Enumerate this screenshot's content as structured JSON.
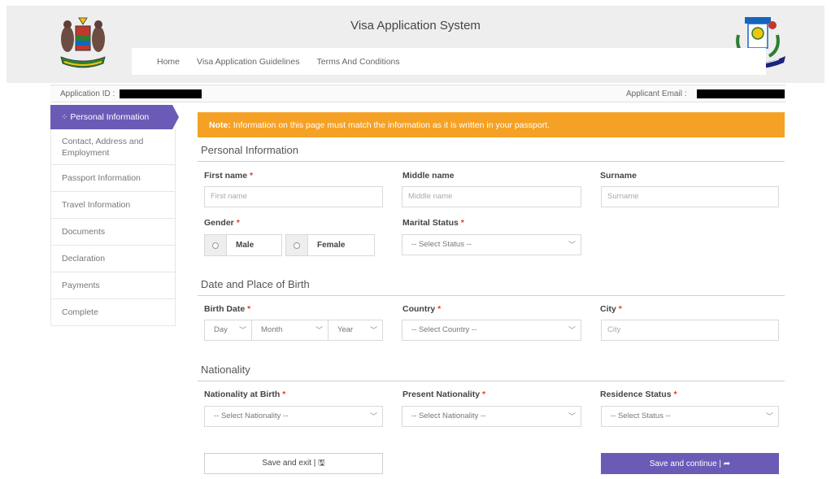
{
  "header": {
    "title": "Visa Application System",
    "nav": [
      "Home",
      "Visa Application Guidelines",
      "Terms And Conditions"
    ],
    "logo_left": "coat-of-arms-icon",
    "logo_right": "immigration-seal-icon"
  },
  "idbar": {
    "application_id_label": "Application ID :",
    "applicant_email_label": "Applicant Email :"
  },
  "sidebar": {
    "items": [
      {
        "label": "Personal Information",
        "active": true
      },
      {
        "label": "Contact, Address and Employment"
      },
      {
        "label": "Passport Information"
      },
      {
        "label": "Travel Information"
      },
      {
        "label": "Documents"
      },
      {
        "label": "Declaration"
      },
      {
        "label": "Payments"
      },
      {
        "label": "Complete"
      }
    ]
  },
  "note": {
    "bold": "Note:",
    "text": " Information on this page must match the information as it is written in your passport."
  },
  "personal": {
    "title": "Personal Information",
    "first_name": {
      "label": "First name",
      "placeholder": "First name"
    },
    "middle_name": {
      "label": "Middle name",
      "placeholder": "Middle name"
    },
    "surname": {
      "label": "Surname",
      "placeholder": "Surname"
    },
    "gender": {
      "label": "Gender",
      "options": [
        "Male",
        "Female"
      ]
    },
    "marital_status": {
      "label": "Marital Status",
      "value": "-- Select Status --"
    }
  },
  "birth": {
    "title": "Date and Place of Birth",
    "birth_date": {
      "label": "Birth Date",
      "day": "Day",
      "month": "Month",
      "year": "Year"
    },
    "country": {
      "label": "Country",
      "value": "-- Select Country --"
    },
    "city": {
      "label": "City",
      "placeholder": "City"
    }
  },
  "nationality": {
    "title": "Nationality",
    "at_birth": {
      "label": "Nationality at Birth",
      "value": "-- Select Nationality --"
    },
    "present": {
      "label": "Present Nationality",
      "value": "-- Select Nationality --"
    },
    "residence": {
      "label": "Residence Status",
      "value": "-- Select Status --"
    }
  },
  "buttons": {
    "save_exit": "Save and exit | 🖫",
    "save_continue": "Save and continue | ➦"
  },
  "colors": {
    "primary": "#6b5bb7",
    "note": "#f5a125",
    "required": "#e53935"
  }
}
